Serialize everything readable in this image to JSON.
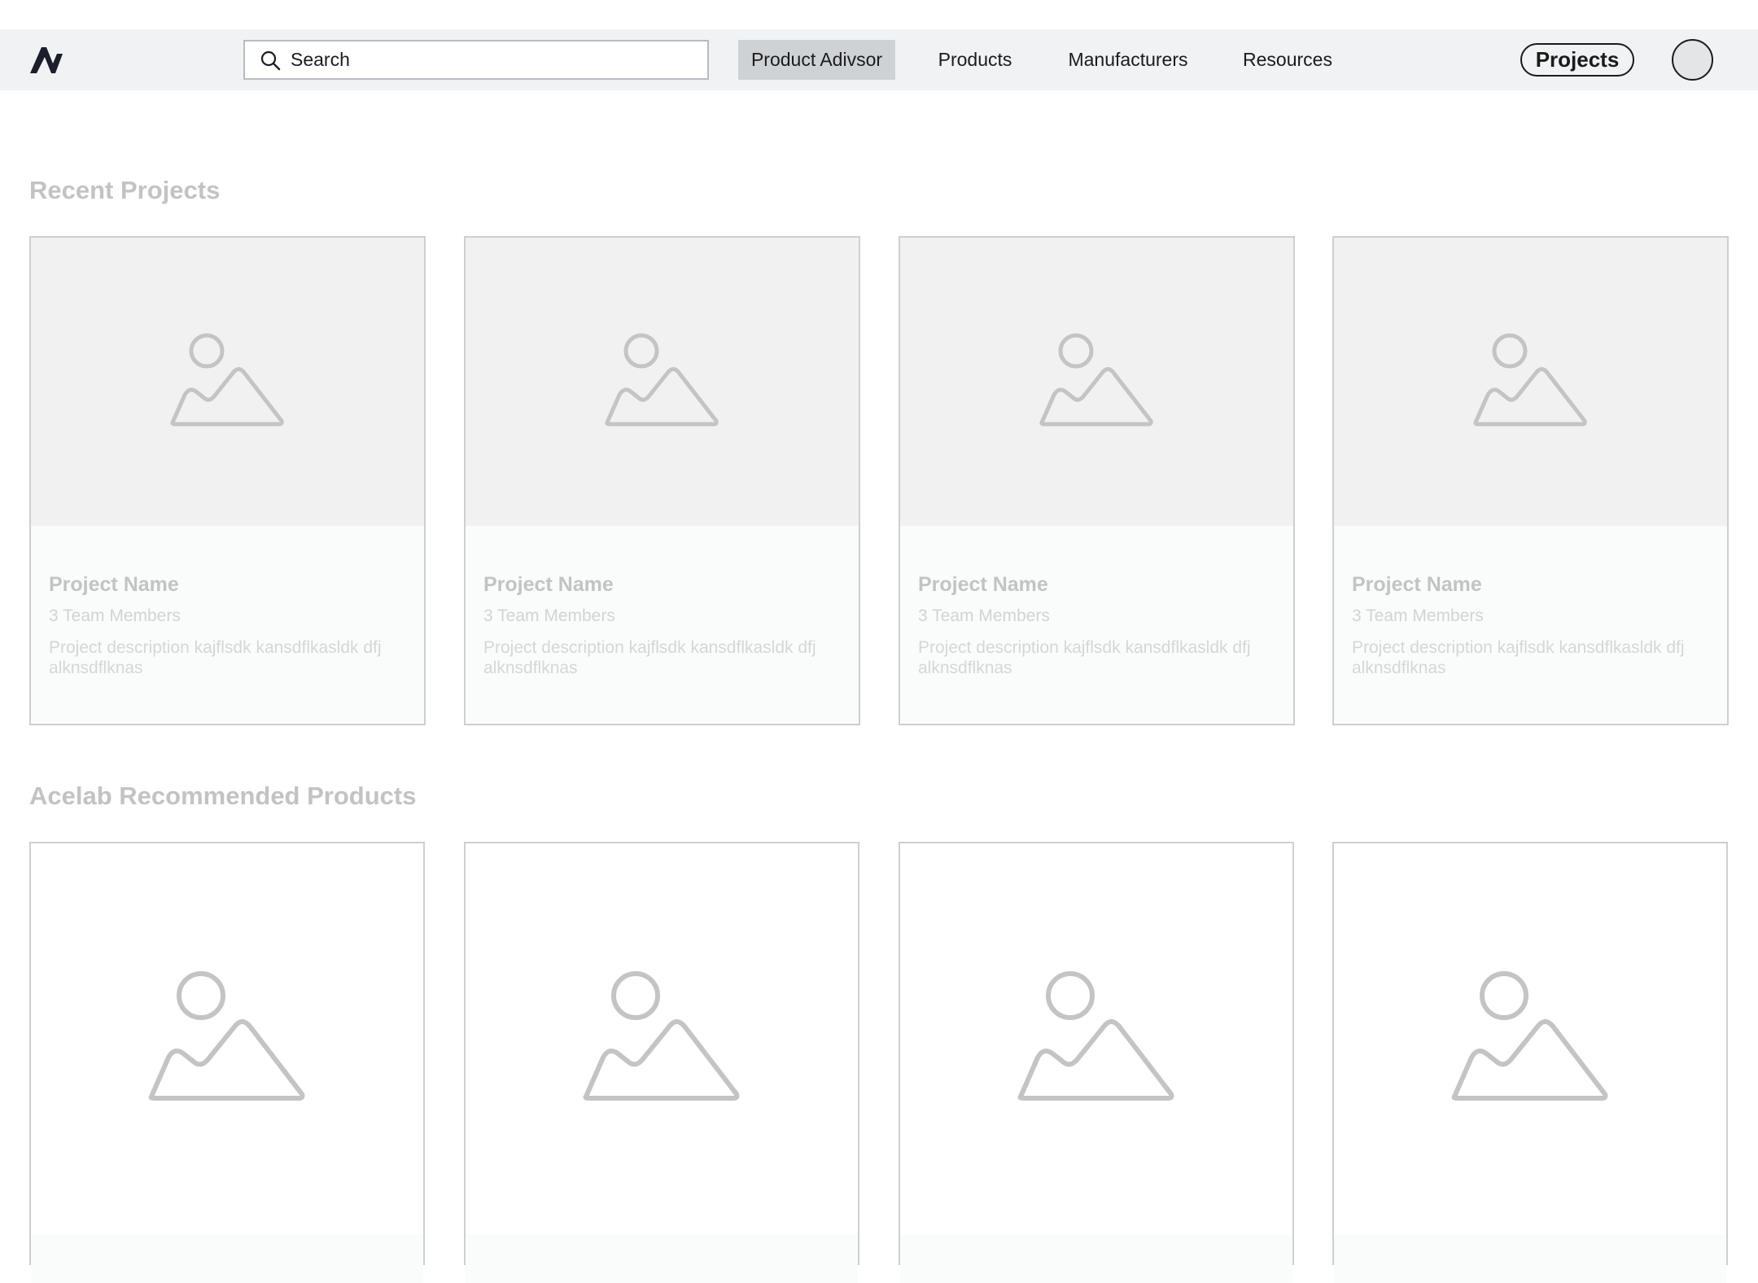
{
  "header": {
    "search_placeholder": "Search",
    "nav": [
      "Product Adivsor",
      "Products",
      "Manufacturers",
      "Resources"
    ],
    "active_nav": "Product Adivsor",
    "projects_label": "Projects"
  },
  "recent_projects": {
    "title": "Recent Projects",
    "cards": [
      {
        "name": "Project Name",
        "members": "3 Team Members",
        "description": "Project description kajflsdk kansdflkasldk dfj alknsdflknas"
      },
      {
        "name": "Project Name",
        "members": "3 Team Members",
        "description": "Project description kajflsdk kansdflkasldk dfj alknsdflknas"
      },
      {
        "name": "Project Name",
        "members": "3 Team Members",
        "description": "Project description kajflsdk kansdflkasldk dfj alknsdflknas"
      },
      {
        "name": "Project Name",
        "members": "3 Team Members",
        "description": "Project description kajflsdk kansdflkasldk dfj alknsdflknas"
      }
    ]
  },
  "recommended_products": {
    "title": "Acelab Recommended Products"
  },
  "icons": {
    "logo": "brand-logo-icon",
    "search": "search-icon",
    "placeholder_image": "image-placeholder-icon"
  },
  "colors": {
    "navbar_bg": "#f1f2f3",
    "active_nav_bg": "#cfd2d5",
    "text_dark": "#1b1b1b",
    "muted_text": "#c3c3c3",
    "card_border": "#cfcfcf",
    "thumb_bg": "#f1f1f1"
  }
}
